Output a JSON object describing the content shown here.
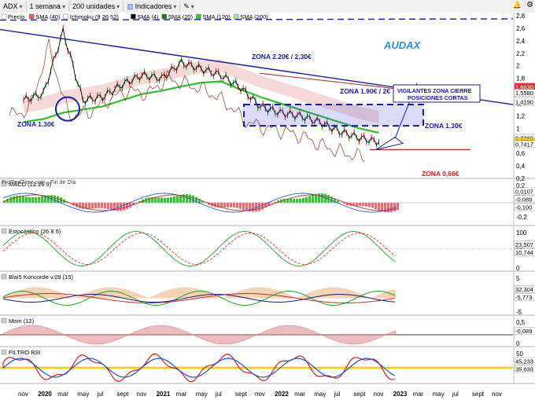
{
  "toolbar": {
    "symbol": "ADX",
    "period": "1 semana",
    "units": "200 unidades",
    "indicators": "Indicadores",
    "icons": [
      "chevron-down-icon",
      "chevron-down-icon",
      "chevron-down-icon",
      "pencil-icon",
      "bell-icon",
      "settings-icon"
    ]
  },
  "legend": [
    {
      "label": "Precio",
      "color": "#ffffff"
    },
    {
      "label": "SMA (40)",
      "color": "#e06060"
    },
    {
      "label": "Ichimoku (9 26 52)",
      "color": "#ffffff"
    },
    {
      "label": "SMA (4)",
      "color": "#000000"
    },
    {
      "label": "SMA (20)",
      "color": "#1e7b1e"
    },
    {
      "label": "SMA (120)",
      "color": "#33cc33"
    },
    {
      "label": "SMA (200)",
      "color": "#b0e0b0"
    }
  ],
  "price_axis": {
    "ticks": [
      "2,8",
      "2,6",
      "2,4",
      "2,2",
      "2",
      "1,8",
      "1,6",
      "1,4",
      "1,2",
      "1",
      "0,8",
      "0,6",
      "0,4",
      "0,2"
    ],
    "labels": [
      {
        "text": "1,6630",
        "bg": "#e03030"
      },
      {
        "text": "1,5580",
        "bg": "#ffffff"
      },
      {
        "text": "1,4190",
        "bg": "#ffffff"
      },
      {
        "text": "0,8369",
        "bg": "#ffffff"
      },
      {
        "text": "0,7775",
        "bg": "#ffcc00"
      },
      {
        "text": "0,7417",
        "bg": "#ffffff"
      }
    ]
  },
  "annotations": {
    "title": "AUDAX",
    "zona_220": "ZONA 2.20€ / 2,30€",
    "zona_190": "ZONA 1.90€ / 2€",
    "vigilantes": "VIGILANTES ZONA CIERRE POSICIONES CORTAS",
    "zona_130_left": "ZONA 1.30€",
    "zona_130_right": "ZONA 1.30€",
    "zona_066": "ZONA 0,66€",
    "footer": "ProRealTime.com - Fin de Día"
  },
  "panels": [
    {
      "name": "MACD (12 26 9)",
      "ticks": [
        "0,2",
        "0,1",
        "-0,1",
        "-0,2"
      ],
      "labels": [
        "0,0107",
        "-0,089",
        "-0,100"
      ]
    },
    {
      "name": "Estocástico (26 8 5)",
      "ticks": [
        "100",
        "50",
        "0"
      ],
      "labels": [
        "23,507",
        "10,744"
      ]
    },
    {
      "name": "Blai5 Koncorde v.09 (15)",
      "ticks": [
        "5",
        "-5"
      ],
      "labels": [
        "32,304",
        "-5,773"
      ]
    },
    {
      "name": "Mom (12)",
      "ticks": [
        "0,5",
        "0"
      ],
      "labels": [
        "-0,089"
      ]
    },
    {
      "name": "FILTRO RSI",
      "ticks": [
        "50"
      ],
      "labels": [
        "45,233",
        "35,633"
      ]
    }
  ],
  "x_axis": [
    "nov",
    "2020",
    "mar",
    "may",
    "jul",
    "sept",
    "nov",
    "2021",
    "mar",
    "may",
    "jul",
    "sept",
    "nov",
    "2022",
    "mar",
    "may",
    "jul",
    "sept",
    "nov",
    "2023",
    "mar",
    "may",
    "jul",
    "sept",
    "nov"
  ],
  "chart_data": {
    "type": "line",
    "title": "AUDAX",
    "xlabel": "",
    "ylabel": "",
    "ylim": [
      0.2,
      2.8
    ],
    "x": [
      "nov",
      "2020",
      "mar",
      "may",
      "jul",
      "sept",
      "nov",
      "2021",
      "mar",
      "may",
      "jul",
      "sept",
      "nov",
      "2022",
      "mar",
      "may",
      "jul",
      "sept",
      "nov"
    ],
    "series": [
      {
        "name": "Precio",
        "values": [
          1.45,
          1.55,
          2.55,
          1.45,
          1.5,
          1.7,
          1.85,
          1.8,
          2.05,
          1.95,
          1.85,
          1.65,
          1.35,
          1.25,
          1.2,
          1.1,
          0.95,
          0.85,
          0.78
        ]
      },
      {
        "name": "SMA (120)",
        "values": [
          1.1,
          1.15,
          1.25,
          1.3,
          1.35,
          1.45,
          1.55,
          1.6,
          1.67,
          1.73,
          1.75,
          1.62,
          1.5,
          1.4,
          1.3,
          1.2,
          1.1,
          1.0,
          0.93
        ]
      }
    ]
  }
}
